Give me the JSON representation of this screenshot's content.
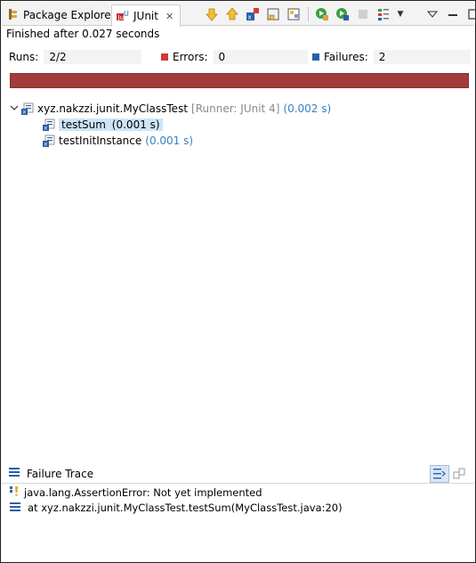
{
  "tabs": {
    "package_explorer": "Package Explorer",
    "junit": "JUnit"
  },
  "status": "Finished after 0.027 seconds",
  "counters": {
    "runs_label": "Runs:",
    "runs_value": "2/2",
    "errors_label": "Errors:",
    "errors_value": "0",
    "failures_label": "Failures:",
    "failures_value": "2"
  },
  "progress": {
    "color": "#a23b3b",
    "fraction": 1.0
  },
  "tree": {
    "root": {
      "name": "xyz.nakzzi.junit.MyClassTest",
      "runner": "[Runner: JUnit 4]",
      "time": "(0.002 s)"
    },
    "children": [
      {
        "name": "testSum",
        "time": "(0.001 s)",
        "selected": true
      },
      {
        "name": "testInitInstance",
        "time": "(0.001 s)",
        "selected": false
      }
    ]
  },
  "failure_trace": {
    "title": "Failure Trace",
    "lines": [
      "java.lang.AssertionError: Not yet implemented",
      "at xyz.nakzzi.junit.MyClassTest.testSum(MyClassTest.java:20)"
    ]
  },
  "colors": {
    "failure": "#2b5fa8",
    "error": "#d23a3a",
    "selection": "#cde5f8",
    "time": "#3a80c0"
  },
  "icons": {
    "package_explorer_tab": "package-explorer-icon",
    "junit_tab": "junit-icon",
    "next_failure": "arrow-down-icon",
    "prev_failure": "arrow-up-icon",
    "show_failures_only": "failures-only-icon",
    "scroll_lock": "scroll-lock-icon",
    "layout": "hierarchy-icon",
    "rerun": "rerun-icon",
    "rerun_failed": "rerun-failed-icon",
    "stop": "stop-icon",
    "history": "history-icon",
    "view_menu": "view-menu-icon",
    "minimize": "minimize-icon",
    "maximize": "maximize-icon"
  }
}
